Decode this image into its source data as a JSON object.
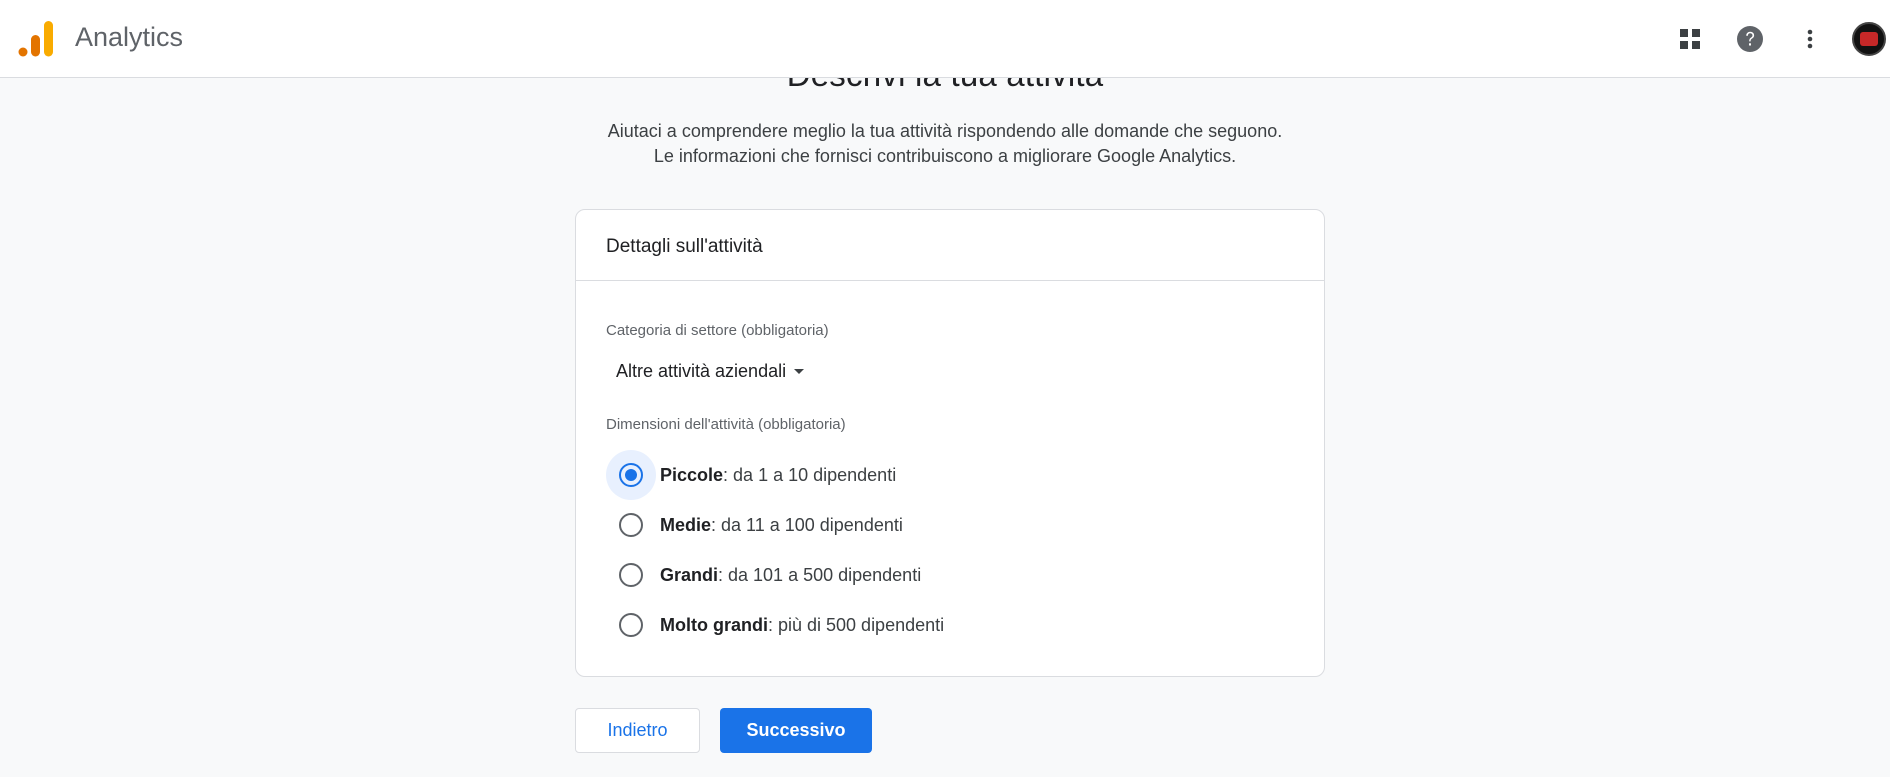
{
  "header": {
    "app_name": "Analytics",
    "brand_colors": {
      "bar_dark": "#e37400",
      "bar_light": "#f9ab00"
    },
    "icons": [
      "apps-grid-icon",
      "help-icon",
      "more-vert-icon"
    ]
  },
  "main": {
    "title": "Descrivi la tua attività",
    "subtitle_line1": "Aiutaci a comprendere meglio la tua attività rispondendo alle domande che seguono.",
    "subtitle_line2": "Le informazioni che fornisci contribuiscono a migliorare Google Analytics."
  },
  "card": {
    "header": "Dettagli sull'attività",
    "industry_label": "Categoria di settore (obbligatoria)",
    "industry_value": "Altre attività aziendali",
    "size_label": "Dimensioni dell'attività (obbligatoria)",
    "size_options": [
      {
        "bold": "Piccole",
        "rest": ": da 1 a 10 dipendenti",
        "selected": true
      },
      {
        "bold": "Medie",
        "rest": ": da 11 a 100 dipendenti",
        "selected": false
      },
      {
        "bold": "Grandi",
        "rest": ": da 101 a 500 dipendenti",
        "selected": false
      },
      {
        "bold": "Molto grandi",
        "rest": ": più di 500 dipendenti",
        "selected": false
      }
    ]
  },
  "buttons": {
    "back_label": "Indietro",
    "next_label": "Successivo"
  },
  "colors": {
    "accent": "#1a73e8",
    "background": "#f8f9fa"
  }
}
